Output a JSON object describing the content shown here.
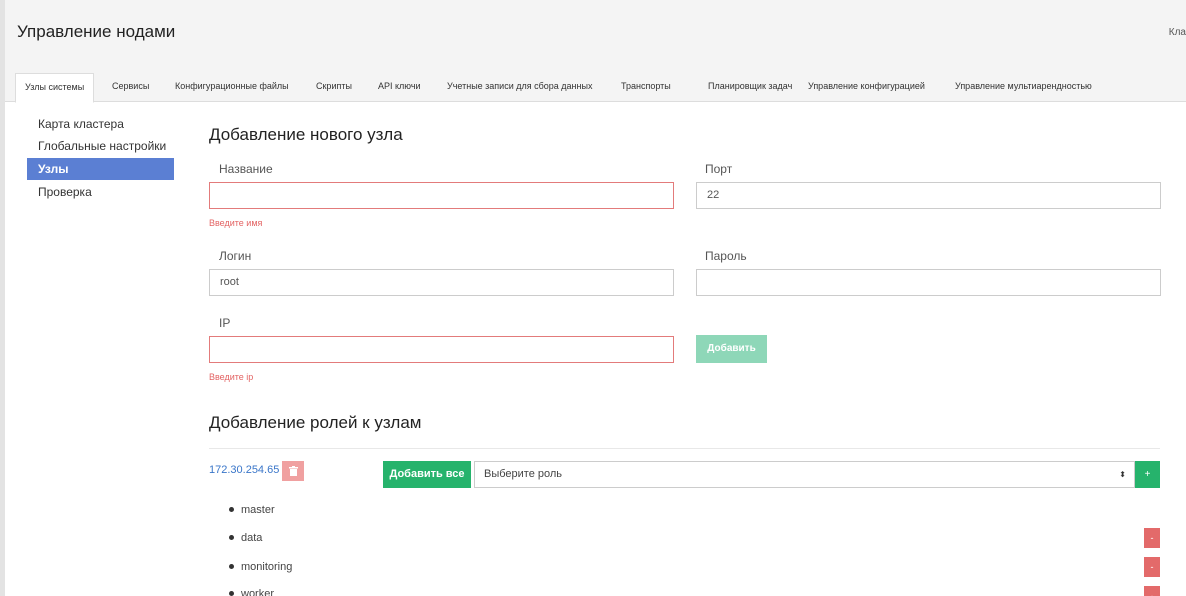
{
  "header": {
    "title": "Управление нодами",
    "user_truncated": "Кла"
  },
  "tabs": [
    {
      "label": "Узлы системы",
      "active": true
    },
    {
      "label": "Сервисы"
    },
    {
      "label": "Конфигурационные файлы"
    },
    {
      "label": "Скрипты"
    },
    {
      "label": "API ключи"
    },
    {
      "label": "Учетные записи для сбора данных"
    },
    {
      "label": "Транспорты"
    },
    {
      "label": "Планировщик задач"
    },
    {
      "label": "Управление конфигурацией"
    },
    {
      "label": "Управление мультиарендностью"
    }
  ],
  "sidebar": {
    "items": [
      {
        "label": "Карта кластера"
      },
      {
        "label": "Глобальные настройки"
      },
      {
        "label": "Узлы",
        "active": true
      },
      {
        "label": "Проверка"
      }
    ]
  },
  "add_node": {
    "title": "Добавление нового узла",
    "name_label": "Название",
    "name_value": "",
    "name_error": "Введите имя",
    "port_label": "Порт",
    "port_value": "22",
    "login_label": "Логин",
    "login_value": "root",
    "password_label": "Пароль",
    "password_value": "",
    "ip_label": "IP",
    "ip_value": "",
    "ip_error": "Введите ip",
    "add_button": "Добавить"
  },
  "roles": {
    "title": "Добавление ролей к узлам",
    "node_ip": "172.30.254.65",
    "add_all_button": "Добавить все",
    "select_placeholder": "Выберите роль",
    "plus_label": "+",
    "minus_label": "-",
    "items": [
      {
        "name": "master"
      },
      {
        "name": "data"
      },
      {
        "name": "monitoring"
      },
      {
        "name": "worker"
      }
    ]
  },
  "colors": {
    "sidebar_active": "#5b7fd3",
    "error": "#e36464",
    "primary_green": "#26b36c",
    "disabled_green": "#8ed7b8",
    "danger": "#e36a6a",
    "link": "#3a76c9"
  },
  "icons": {
    "delete": "trash-icon",
    "select": "sort-arrows-icon"
  }
}
